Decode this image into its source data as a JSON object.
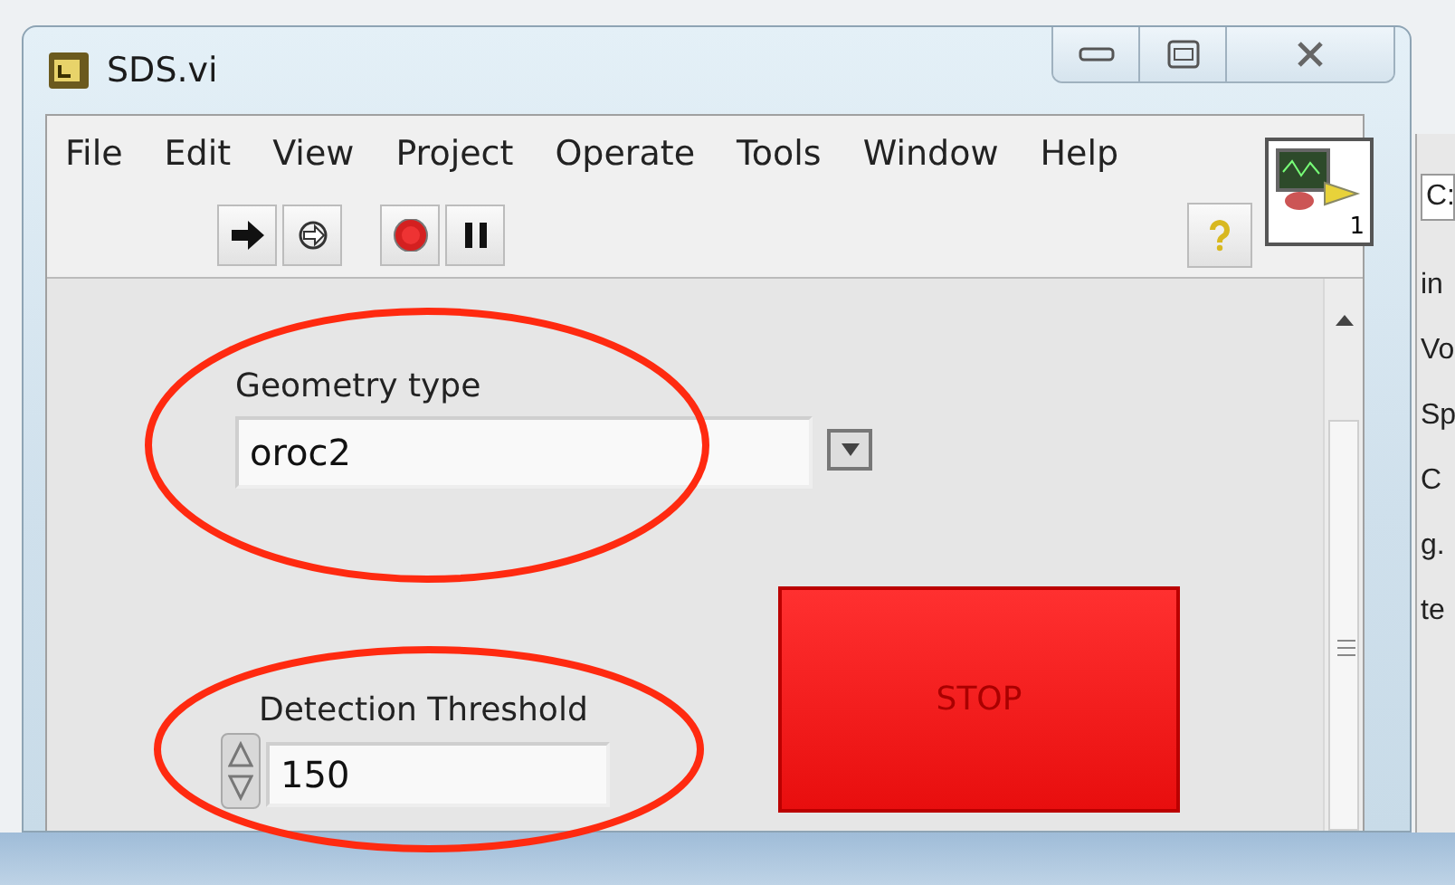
{
  "window": {
    "title": "SDS.vi"
  },
  "menu": [
    "File",
    "Edit",
    "View",
    "Project",
    "Operate",
    "Tools",
    "Window",
    "Help"
  ],
  "toolbar": [
    {
      "kind": "run"
    },
    {
      "kind": "run_continuous"
    },
    {
      "kind": "abort"
    },
    {
      "kind": "pause"
    },
    {
      "kind": "help"
    }
  ],
  "vi_icon": {
    "text": "1"
  },
  "controls": [
    {
      "kind": "ring",
      "label": "Geometry type",
      "value": "oroc2"
    },
    {
      "kind": "button",
      "text": "STOP"
    },
    {
      "kind": "numeric",
      "label": "Detection Threshold",
      "value": "150"
    }
  ],
  "annotations": [
    {
      "kind": "ellipse"
    },
    {
      "kind": "ellipse"
    }
  ],
  "background_window": {
    "texts": [
      "C:",
      "in",
      "Vo",
      "Sp",
      "C",
      "g.",
      "te"
    ]
  }
}
